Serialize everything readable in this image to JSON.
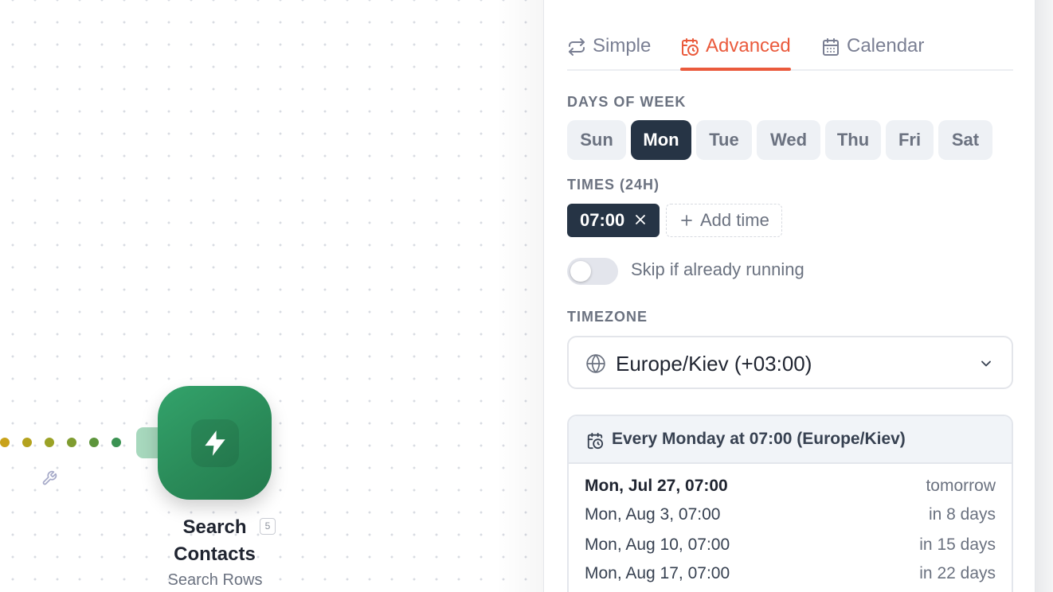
{
  "canvas": {
    "node": {
      "title": "Search Contacts",
      "title_line1": "Search",
      "title_line2": "Contacts",
      "badge": "5",
      "subtitle": "Search Rows",
      "color": "#2e9463",
      "icon": "lightning-icon"
    },
    "connector_dot_colors": [
      "#c9a21a",
      "#b4a21e",
      "#9ba226",
      "#7f9c30",
      "#5d953c",
      "#3b9252"
    ]
  },
  "panel": {
    "tabs": [
      {
        "label": "Simple",
        "icon": "repeat-icon",
        "active": false
      },
      {
        "label": "Advanced",
        "icon": "calendar-clock-icon",
        "active": true
      },
      {
        "label": "Calendar",
        "icon": "calendar-icon",
        "active": false
      }
    ],
    "accent_color": "#ea5a3c",
    "days_label": "DAYS OF WEEK",
    "days": [
      {
        "label": "Sun",
        "selected": false
      },
      {
        "label": "Mon",
        "selected": true
      },
      {
        "label": "Tue",
        "selected": false
      },
      {
        "label": "Wed",
        "selected": false
      },
      {
        "label": "Thu",
        "selected": false
      },
      {
        "label": "Fri",
        "selected": false
      },
      {
        "label": "Sat",
        "selected": false
      }
    ],
    "times_label": "TIMES (24H)",
    "times": [
      "07:00"
    ],
    "add_time_label": "Add time",
    "skip_toggle": {
      "label": "Skip if already running",
      "on": false
    },
    "timezone_label": "TIMEZONE",
    "timezone_value": "Europe/Kiev (+03:00)",
    "summary": "Every Monday at 07:00 (Europe/Kiev)",
    "upcoming_runs": [
      {
        "date": "Mon, Jul 27, 07:00",
        "relative": "tomorrow"
      },
      {
        "date": "Mon, Aug 3, 07:00",
        "relative": "in 8 days"
      },
      {
        "date": "Mon, Aug 10, 07:00",
        "relative": "in 15 days"
      },
      {
        "date": "Mon, Aug 17, 07:00",
        "relative": "in 22 days"
      }
    ]
  }
}
